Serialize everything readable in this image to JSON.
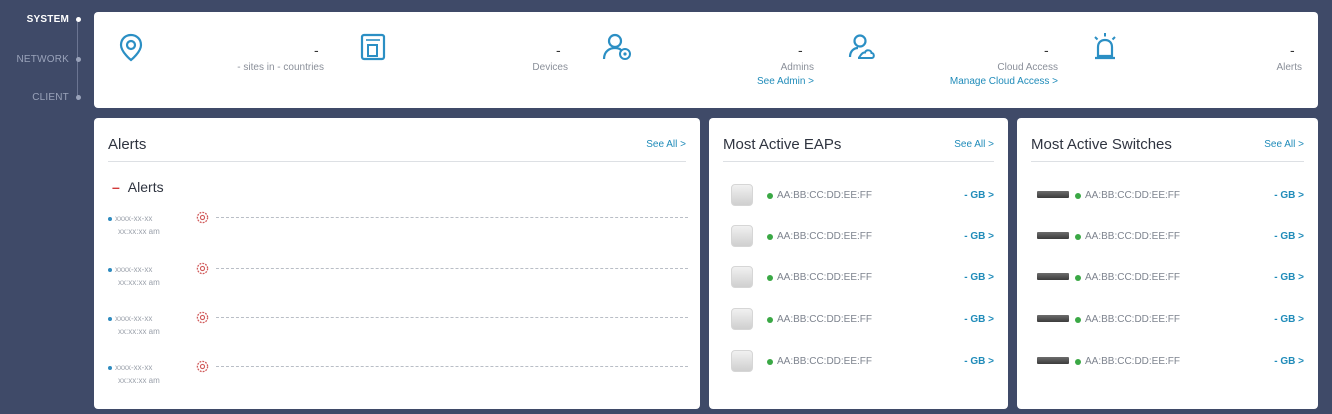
{
  "nav": {
    "system": "SYSTEM",
    "network": "NETWORK",
    "client": "CLIENT"
  },
  "summary": {
    "sites": {
      "value": "-",
      "label": "- sites in - countries",
      "icon": "location-pin-icon"
    },
    "devices": {
      "value": "-",
      "label": "Devices",
      "icon": "device-icon"
    },
    "admins": {
      "value": "-",
      "label": "Admins",
      "link": "See Admin >",
      "icon": "admin-users-icon"
    },
    "cloud": {
      "value": "-",
      "label": "Cloud Access",
      "link": "Manage Cloud Access >",
      "icon": "cloud-user-icon"
    },
    "alerts": {
      "value": "-",
      "label": "Alerts",
      "icon": "siren-icon"
    }
  },
  "alerts_card": {
    "title": "Alerts",
    "see_all": "See All >",
    "section_label": "Alerts",
    "items": [
      {
        "date": "xxxx-xx-xx",
        "time": "xx:xx:xx am"
      },
      {
        "date": "xxxx-xx-xx",
        "time": "xx:xx:xx am"
      },
      {
        "date": "xxxx-xx-xx",
        "time": "xx:xx:xx am"
      },
      {
        "date": "xxxx-xx-xx",
        "time": "xx:xx:xx am"
      }
    ]
  },
  "eaps_card": {
    "title": "Most Active EAPs",
    "see_all": "See All >",
    "rows": [
      {
        "mac": "AA:BB:CC:DD:EE:FF",
        "usage": "- GB >"
      },
      {
        "mac": "AA:BB:CC:DD:EE:FF",
        "usage": "- GB >"
      },
      {
        "mac": "AA:BB:CC:DD:EE:FF",
        "usage": "- GB >"
      },
      {
        "mac": "AA:BB:CC:DD:EE:FF",
        "usage": "- GB >"
      },
      {
        "mac": "AA:BB:CC:DD:EE:FF",
        "usage": "- GB >"
      }
    ]
  },
  "switches_card": {
    "title": "Most Active Switches",
    "see_all": "See All >",
    "rows": [
      {
        "mac": "AA:BB:CC:DD:EE:FF",
        "usage": "- GB >"
      },
      {
        "mac": "AA:BB:CC:DD:EE:FF",
        "usage": "- GB >"
      },
      {
        "mac": "AA:BB:CC:DD:EE:FF",
        "usage": "- GB >"
      },
      {
        "mac": "AA:BB:CC:DD:EE:FF",
        "usage": "- GB >"
      },
      {
        "mac": "AA:BB:CC:DD:EE:FF",
        "usage": "- GB >"
      }
    ]
  },
  "colors": {
    "background": "#3f4a68",
    "accent": "#1f8bb9",
    "online": "#3aa845",
    "alert": "#d23a3a"
  }
}
